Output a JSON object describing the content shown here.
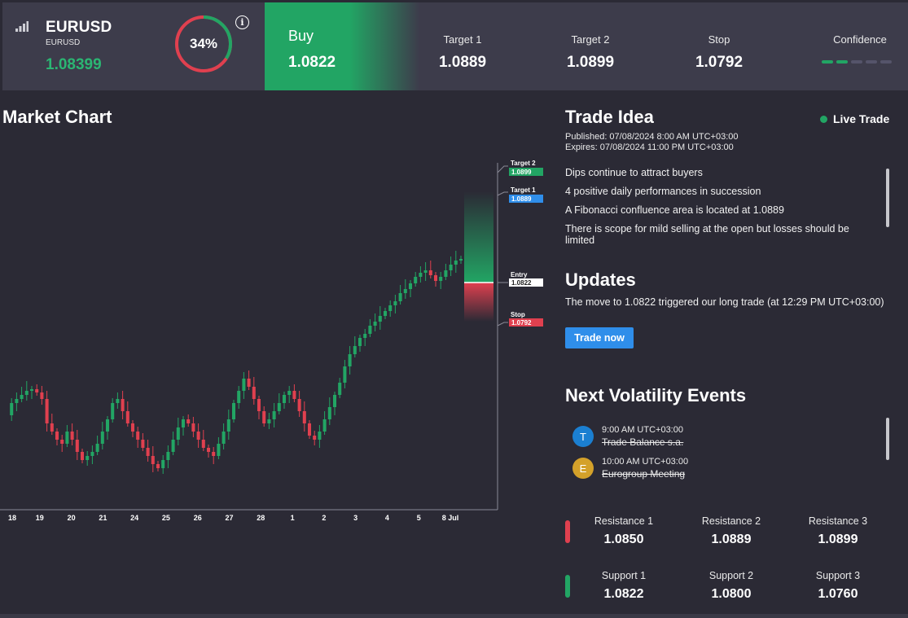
{
  "header": {
    "symbol": "EURUSD",
    "symbol_sub": "EURUSD",
    "price": "1.08399",
    "gauge_percent": 34,
    "gauge_label": "34%",
    "info_glyph": "i",
    "direction_label": "Buy",
    "entry_price": "1.0822",
    "stats": [
      {
        "label": "Target 1",
        "value": "1.0889"
      },
      {
        "label": "Target 2",
        "value": "1.0899"
      },
      {
        "label": "Stop",
        "value": "1.0792"
      }
    ],
    "confidence_label": "Confidence",
    "confidence_level": 2,
    "confidence_max": 5
  },
  "colors": {
    "green": "#22a564",
    "red": "#e0404f",
    "blue": "#2f8eea",
    "panel": "#3d3c4b",
    "background": "#2b2a35"
  },
  "chart": {
    "title": "Market Chart",
    "x_labels": [
      "18",
      "19",
      "20",
      "21",
      "24",
      "25",
      "26",
      "27",
      "28",
      "1",
      "2",
      "3",
      "4",
      "5",
      "8 Jul"
    ],
    "markers": [
      {
        "label": "Target 2",
        "value": "1.0899",
        "color": "#22a564"
      },
      {
        "label": "Target 1",
        "value": "1.0889",
        "color": "#2f8eea"
      },
      {
        "label": "Entry",
        "value": "1.0822",
        "color": "#ffffff"
      },
      {
        "label": "Stop",
        "value": "1.0792",
        "color": "#e0404f"
      }
    ]
  },
  "trade_idea": {
    "title": "Trade Idea",
    "live_label": "Live Trade",
    "published": "Published:  07/08/2024 8:00 AM UTC+03:00",
    "expires": "Expires:  07/08/2024 11:00 PM UTC+03:00",
    "points": [
      "Dips continue to attract buyers",
      "4 positive daily performances in succession",
      "A Fibonacci confluence area is located at 1.0889",
      "There is scope for mild selling at the open but losses should be limited"
    ]
  },
  "updates": {
    "title": "Updates",
    "text": "The move to 1.0822 triggered our long trade (at 12:29 PM UTC+03:00)",
    "button_label": "Trade now"
  },
  "events": {
    "title": "Next Volatility Events",
    "items": [
      {
        "badge": "T",
        "time": "9:00 AM UTC+03:00",
        "name": "Trade Balance s.a.",
        "color": "#1b7fd1"
      },
      {
        "badge": "E",
        "time": "10:00 AM UTC+03:00",
        "name": "Eurogroup Meeting",
        "color": "#d4a12a"
      }
    ]
  },
  "levels": {
    "resistance": [
      {
        "label": "Resistance 1",
        "value": "1.0850"
      },
      {
        "label": "Resistance 2",
        "value": "1.0889"
      },
      {
        "label": "Resistance 3",
        "value": "1.0899"
      }
    ],
    "support": [
      {
        "label": "Support 1",
        "value": "1.0822"
      },
      {
        "label": "Support 2",
        "value": "1.0800"
      },
      {
        "label": "Support 3",
        "value": "1.0760"
      }
    ]
  }
}
